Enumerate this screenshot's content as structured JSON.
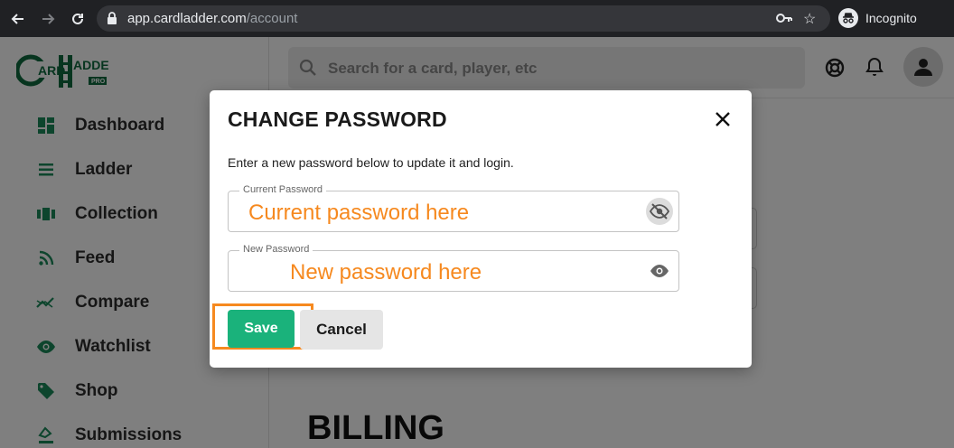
{
  "browser": {
    "url_host": "app.cardladder.com",
    "url_path": "/account",
    "profile_label": "Incognito"
  },
  "logo": {
    "text": "CARD LADDER",
    "badge": "PRO"
  },
  "sidebar": {
    "items": [
      {
        "label": "Dashboard",
        "icon": "dashboard-icon"
      },
      {
        "label": "Ladder",
        "icon": "list-icon"
      },
      {
        "label": "Collection",
        "icon": "collection-icon"
      },
      {
        "label": "Feed",
        "icon": "rss-icon"
      },
      {
        "label": "Compare",
        "icon": "compare-icon"
      },
      {
        "label": "Watchlist",
        "icon": "eye-icon"
      },
      {
        "label": "Shop",
        "icon": "tag-icon"
      },
      {
        "label": "Submissions",
        "icon": "submissions-icon"
      }
    ]
  },
  "topbar": {
    "search_placeholder": "Search for a card, player, etc"
  },
  "page": {
    "section_heading": "BILLING"
  },
  "modal": {
    "title": "CHANGE PASSWORD",
    "description": "Enter a new password below to update it and login.",
    "current_password": {
      "label": "Current Password",
      "value": "Current password here"
    },
    "new_password": {
      "label": "New Password",
      "value": "New password here"
    },
    "save_label": "Save",
    "cancel_label": "Cancel"
  },
  "colors": {
    "brand_green": "#1ab27b",
    "logo_green": "#0f6b3f",
    "annotation_orange": "#f6891f"
  }
}
